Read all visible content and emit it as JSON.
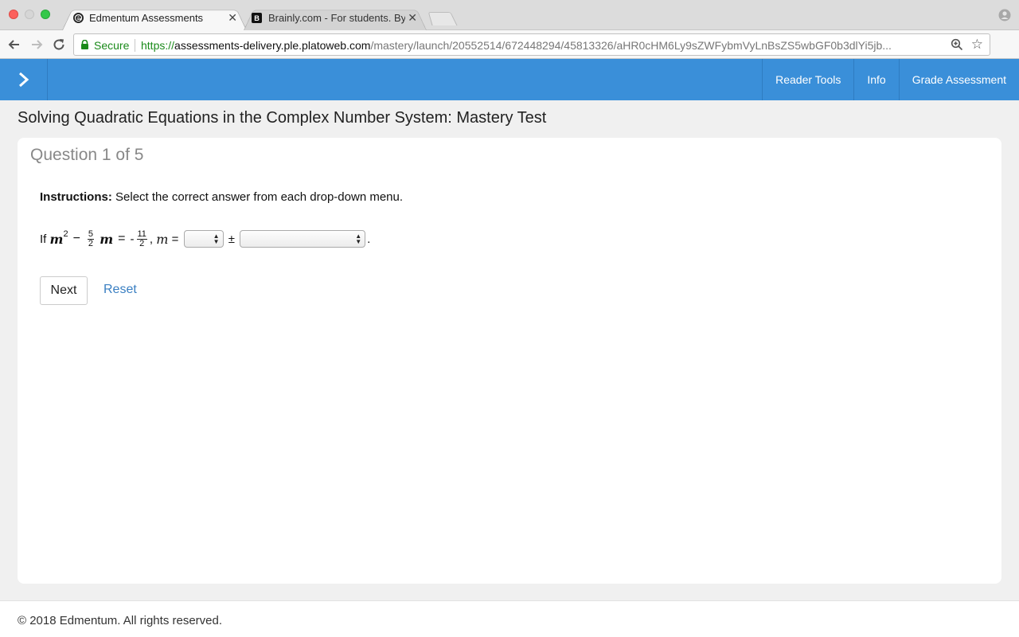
{
  "browser": {
    "tabs": [
      {
        "title": "Edmentum Assessments",
        "active": true,
        "close": "✕"
      },
      {
        "title": "Brainly.com - For students. By",
        "active": false,
        "close": "✕"
      }
    ],
    "secure_label": "Secure",
    "url": {
      "scheme": "https://",
      "host": "assessments-delivery.ple.platoweb.com",
      "path": "/mastery/launch/20552514/672448294/45813326/aHR0cHM6Ly9sZWFybmVyLnBsZS5wbGF0b3dlYi5jb..."
    },
    "icons": {
      "back": "arrow-left",
      "forward": "arrow-right",
      "reload": "reload",
      "lock": "lock",
      "zoom": "magnifier",
      "bookmark": "star",
      "extension": "extension",
      "profile": "person"
    }
  },
  "header": {
    "nav_items": [
      "Reader Tools",
      "Info",
      "Grade Assessment"
    ],
    "accent_color": "#3a8fd9"
  },
  "page": {
    "title": "Solving Quadratic Equations in the Complex Number System: Mastery Test"
  },
  "question": {
    "header": "Question 1 of 5",
    "instructions_label": "Instructions:",
    "instructions_text": "Select the correct answer from each drop-down menu.",
    "equation": {
      "prefix": "If",
      "var": "m",
      "exponent": "2",
      "minus": "−",
      "frac1_num": "5",
      "frac1_den": "2",
      "equals": "=",
      "neg": "-",
      "frac2_num": "11",
      "frac2_den": "2",
      "comma": ",",
      "var2": "m",
      "equals2": "=",
      "plusminus": "±",
      "period": "."
    },
    "dropdown1_value": "",
    "dropdown2_value": ""
  },
  "actions": {
    "next_label": "Next",
    "reset_label": "Reset"
  },
  "footer": {
    "copyright": "© 2018 Edmentum. All rights reserved."
  }
}
